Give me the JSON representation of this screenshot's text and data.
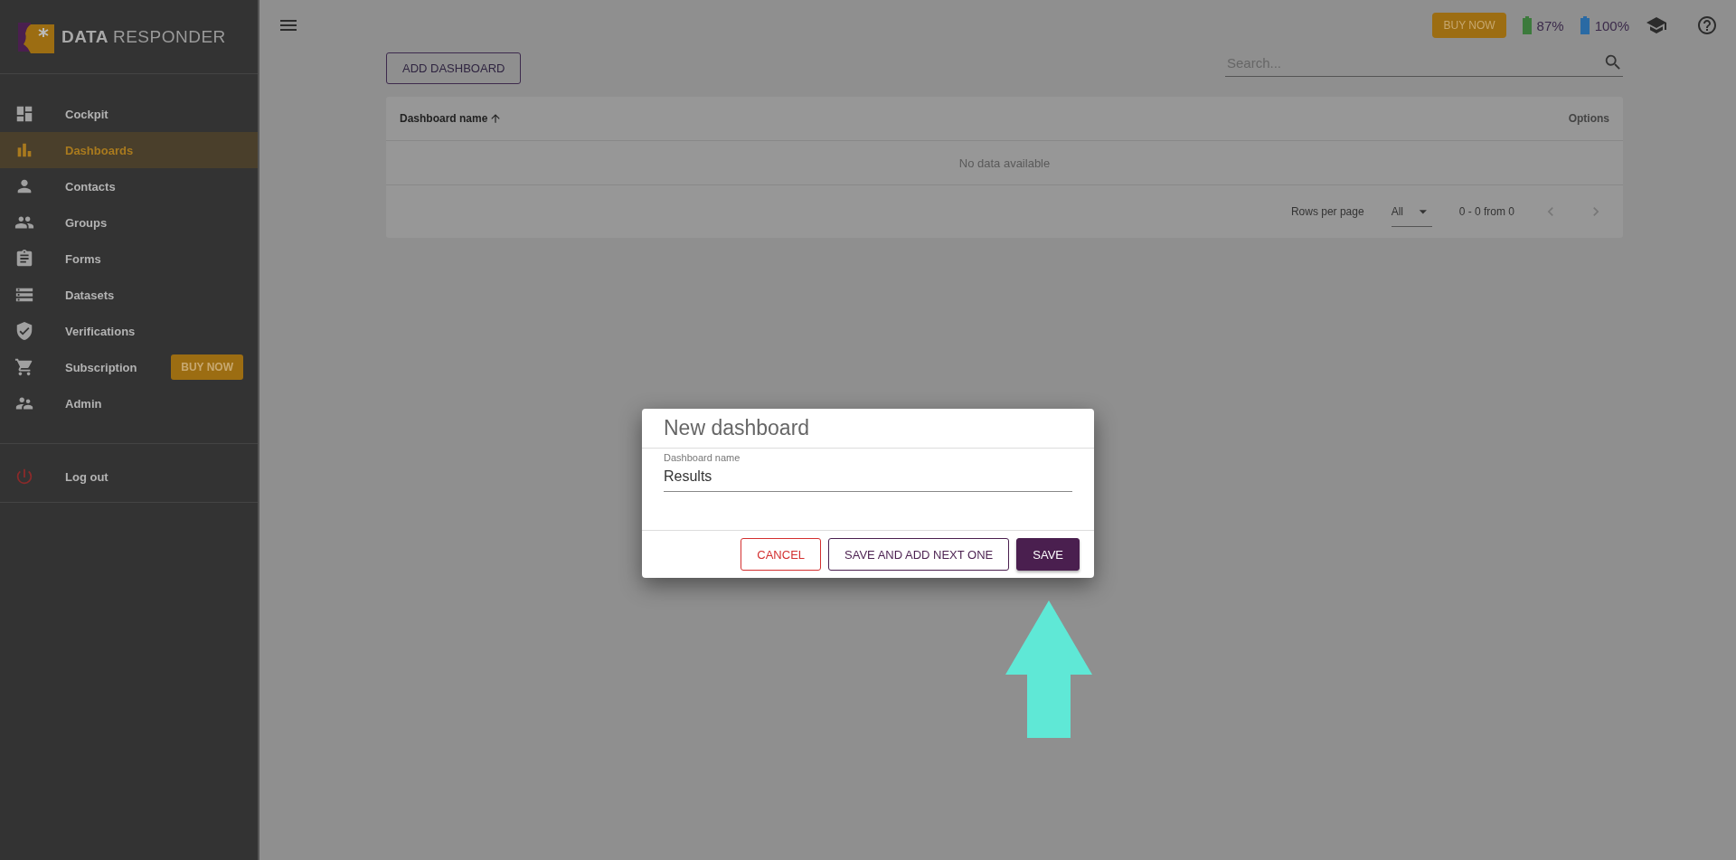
{
  "sidebar": {
    "logo": {
      "bold": "DATA",
      "light": "RESPONDER"
    },
    "items": [
      {
        "label": "Cockpit",
        "selected": false
      },
      {
        "label": "Dashboards",
        "selected": true
      },
      {
        "label": "Contacts",
        "selected": false
      },
      {
        "label": "Groups",
        "selected": false
      },
      {
        "label": "Forms",
        "selected": false
      },
      {
        "label": "Datasets",
        "selected": false
      },
      {
        "label": "Verifications",
        "selected": false
      },
      {
        "label": "Subscription",
        "selected": false,
        "badge": "BUY NOW"
      },
      {
        "label": "Admin",
        "selected": false
      }
    ],
    "logout": {
      "label": "Log out"
    }
  },
  "topbar": {
    "buy_button": "BUY NOW",
    "batteries": [
      {
        "reading": "87%",
        "color": "#3c7a3c"
      },
      {
        "reading": "100%",
        "color": "#2a6aa4"
      }
    ]
  },
  "toolbar": {
    "add_button": "ADD DASHBOARD",
    "search": {
      "placeholder": "Search..."
    }
  },
  "table": {
    "columns": [
      "Dashboard name",
      "Options"
    ],
    "empty_text": "No data available",
    "footer": {
      "rows_per_page_label": "Rows per page",
      "rows_per_page": "All",
      "range": "0 - 0 from 0"
    }
  },
  "dialog": {
    "title": "New dashboard",
    "field": {
      "label": "Dashboard name",
      "value": "Results"
    },
    "buttons": [
      {
        "label": "CANCEL",
        "kind": "cancel"
      },
      {
        "label": "SAVE AND ADD NEXT ONE",
        "kind": "outline"
      },
      {
        "label": "SAVE",
        "kind": "primary"
      }
    ]
  }
}
